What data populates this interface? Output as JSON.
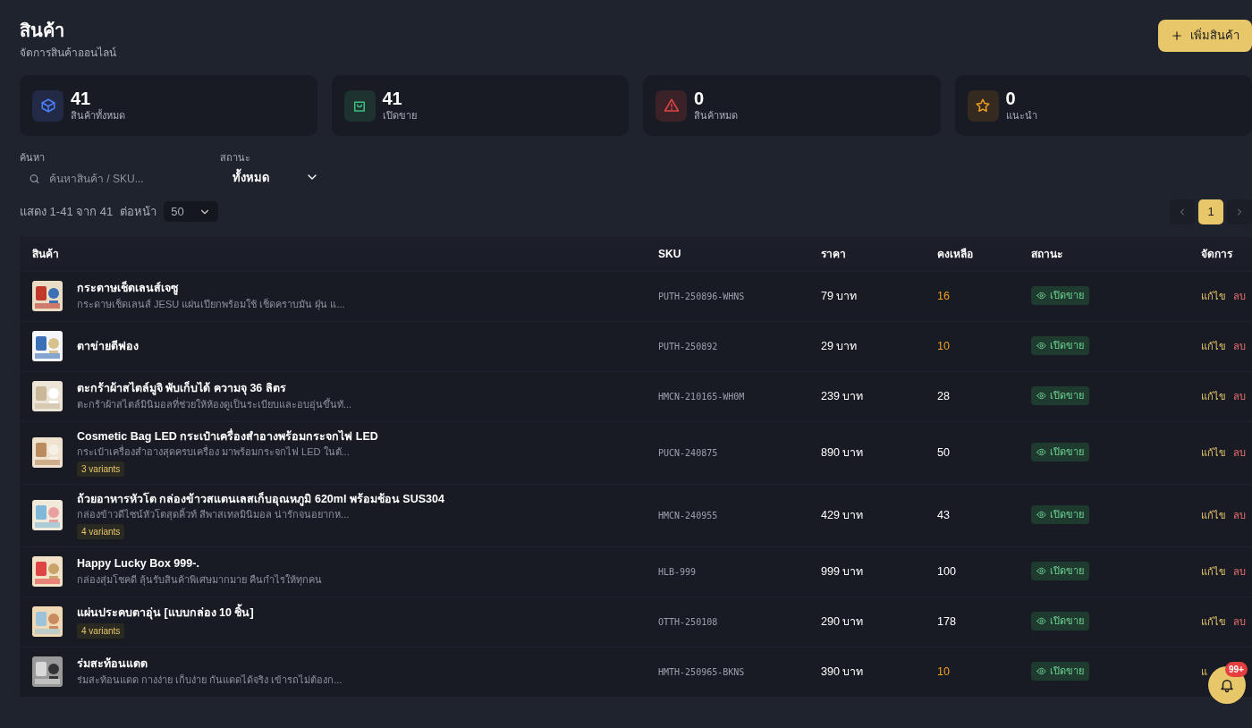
{
  "header": {
    "title": "สินค้า",
    "subtitle": "จัดการสินค้าออนไลน์",
    "add_button": "เพิ่มสินค้า"
  },
  "stats": [
    {
      "kind": "box",
      "value": "41",
      "label": "สินค้าทั้งหมด"
    },
    {
      "kind": "bag",
      "value": "41",
      "label": "เปิดขาย"
    },
    {
      "kind": "warning",
      "value": "0",
      "label": "สินค้าหมด"
    },
    {
      "kind": "star",
      "value": "0",
      "label": "แนะนำ"
    }
  ],
  "filters": {
    "search": {
      "label": "ค้นหา",
      "placeholder": "ค้นหาสินค้า / SKU..."
    },
    "status": {
      "label": "สถานะ",
      "value": "ทั้งหมด"
    }
  },
  "paging": {
    "summary": "แสดง 1-41 จาก 41",
    "per_page_label": "ต่อหน้า",
    "per_page": "50",
    "pages": [
      {
        "label": "1",
        "selected": true
      }
    ]
  },
  "table": {
    "columns": [
      "สินค้า",
      "SKU",
      "ราคา",
      "คงเหลือ",
      "สถานะ",
      "จัดการ"
    ],
    "rows": [
      {
        "name": "กระดาษเช็ดเลนส์เจซู",
        "description": "กระดาษเช็ดเลนส์ JESU แผ่นเปียกพร้อมใช้ เช็ดคราบมัน ฝุ่น แ...",
        "sku": "PUTH-250896-WHNS",
        "price": "79 บาท",
        "stock": "16",
        "low_stock": true,
        "status": "เปิดขาย",
        "actions": [
          {
            "kind": "edit",
            "label": "แก้ไข"
          },
          {
            "kind": "delete",
            "label": "ลบ"
          }
        ]
      },
      {
        "name": "ตาข่ายตีฟอง",
        "sku": "PUTH-250892",
        "price": "29 บาท",
        "stock": "10",
        "low_stock": true,
        "status": "เปิดขาย",
        "actions": [
          {
            "kind": "edit",
            "label": "แก้ไข"
          },
          {
            "kind": "delete",
            "label": "ลบ"
          }
        ]
      },
      {
        "name": "ตะกร้าผ้าสไตล์มูจิ พับเก็บได้ ความจุ 36 ลิตร",
        "description": "ตะกร้าผ้าสไตล์มินิมอลที่ช่วยให้ห้องดูเป็นระเบียบและอบอุ่นขึ้นทั...",
        "sku": "HMCN-210165-WH0M",
        "price": "239 บาท",
        "stock": "28",
        "low_stock": false,
        "status": "เปิดขาย",
        "actions": [
          {
            "kind": "edit",
            "label": "แก้ไข"
          },
          {
            "kind": "delete",
            "label": "ลบ"
          }
        ]
      },
      {
        "name": "Cosmetic Bag LED กระเป๋าเครื่องสำอางพร้อมกระจกไฟ LED",
        "description": "กระเป๋าเครื่องสำอางสุดครบเครื่อง มาพร้อมกระจกไฟ LED ในตั...",
        "variants": "3 variants",
        "sku": "PUCN-240875",
        "price": "890 บาท",
        "stock": "50",
        "low_stock": false,
        "status": "เปิดขาย",
        "actions": [
          {
            "kind": "edit",
            "label": "แก้ไข"
          },
          {
            "kind": "delete",
            "label": "ลบ"
          }
        ]
      },
      {
        "name": "ถ้วยอาหารหัวโต กล่องข้าวสแตนเลสเก็บอุณหภูมิ 620ml พร้อมช้อน SUS304",
        "description": "กล่องข้าวดีไซน์หัวโตสุดคิ้วท์ สีพาสเทลมินิมอล น่ารักจนอยากห...",
        "variants": "4 variants",
        "sku": "HMCN-240955",
        "price": "429 บาท",
        "stock": "43",
        "low_stock": false,
        "status": "เปิดขาย",
        "actions": [
          {
            "kind": "edit",
            "label": "แก้ไข"
          },
          {
            "kind": "delete",
            "label": "ลบ"
          }
        ]
      },
      {
        "name": "Happy Lucky Box 999-.",
        "description": "กล่องสุ่มโชคดี ลุ้นรับสินค้าพิเศษมากมาย คืนกำไรให้ทุกคน",
        "sku": "HLB-999",
        "price": "999 บาท",
        "stock": "100",
        "low_stock": false,
        "status": "เปิดขาย",
        "actions": [
          {
            "kind": "edit",
            "label": "แก้ไข"
          },
          {
            "kind": "delete",
            "label": "ลบ"
          }
        ]
      },
      {
        "name": "แผ่นประคบตาอุ่น [แบบกล่อง 10 ชิ้น]",
        "variants": "4 variants",
        "sku": "OTTH-250108",
        "price": "290 บาท",
        "stock": "178",
        "low_stock": false,
        "status": "เปิดขาย",
        "actions": [
          {
            "kind": "edit",
            "label": "แก้ไข"
          },
          {
            "kind": "delete",
            "label": "ลบ"
          }
        ]
      },
      {
        "name": "ร่มสะท้อนแดด",
        "description": "ร่มสะท้อนแดด กางง่าย เก็บง่าย กันแดดได้จริง เข้ารถไม่ต้องก...",
        "sku": "HMTH-250965-BKNS",
        "price": "390 บาท",
        "stock": "10",
        "low_stock": true,
        "status": "เปิดขาย",
        "actions": [
          {
            "kind": "edit",
            "label": "แ"
          }
        ]
      }
    ]
  },
  "notifications": {
    "badge": "99+"
  }
}
